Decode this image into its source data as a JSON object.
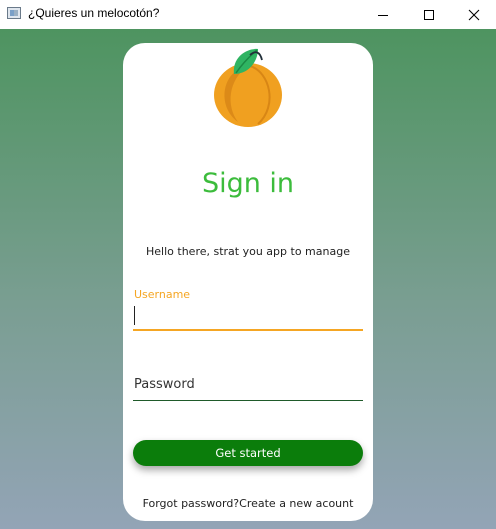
{
  "window": {
    "title": "¿Quieres un melocotón?"
  },
  "card": {
    "logo_icon": "peach-icon",
    "heading": "Sign in",
    "subtitle": "Hello there, strat you app to manage"
  },
  "form": {
    "username_label": "Username",
    "username_value": "",
    "password_placeholder": "Password",
    "password_value": "",
    "submit_label": "Get started"
  },
  "footer": {
    "forgot_password": "Forgot password?",
    "create_account": "Create a new acount"
  },
  "colors": {
    "accent_orange": "#f5a623",
    "heading_green": "#3cbc3c",
    "button_green": "#0b7d0b",
    "gradient_top": "#4e9460",
    "gradient_bottom": "#93a4b6"
  }
}
